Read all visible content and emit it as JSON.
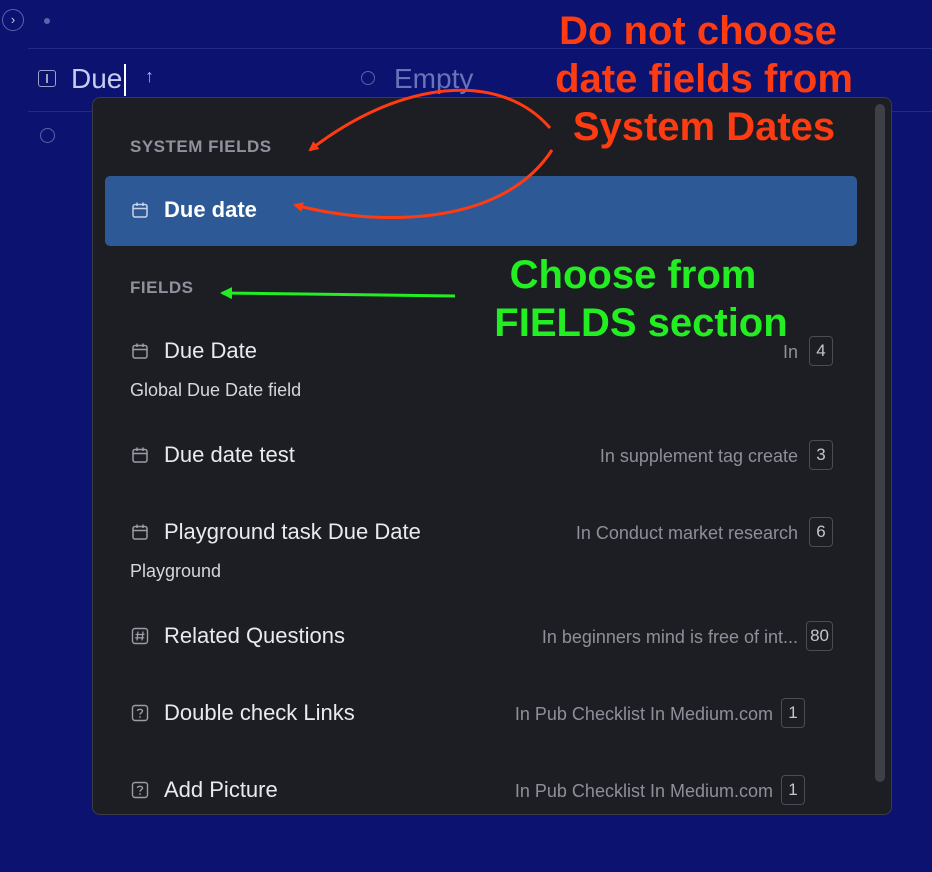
{
  "header": {
    "field_name": "Due",
    "value_placeholder": "Empty",
    "expand_glyph": "›",
    "sort_glyph": "↑"
  },
  "dropdown": {
    "system_section": {
      "title": "SYSTEM FIELDS",
      "items": [
        {
          "name": "Due date",
          "icon": "calendar-icon",
          "selected": true
        }
      ]
    },
    "fields_section": {
      "title": "FIELDS",
      "items": [
        {
          "name": "Due Date",
          "icon": "calendar-icon",
          "subtitle": "Global Due Date field",
          "location": "In",
          "count": "4"
        },
        {
          "name": "Due date test",
          "icon": "calendar-icon",
          "location": "In supplement tag create",
          "count": "3"
        },
        {
          "name": "Playground task Due Date",
          "icon": "calendar-icon",
          "subtitle": "Playground",
          "location": "In Conduct market research",
          "count": "6"
        },
        {
          "name": "Related Questions",
          "icon": "hash-icon",
          "location": "In beginners mind is free of int...",
          "count": "80"
        },
        {
          "name": "Double check Links",
          "icon": "question-icon",
          "location": "In Pub Checklist In Medium.com",
          "count": "1"
        },
        {
          "name": "Add Picture",
          "icon": "question-icon",
          "location": "In Pub Checklist In Medium.com",
          "count": "1"
        }
      ]
    }
  },
  "annotations": {
    "red_lines": [
      "Do not choose",
      "date fields from",
      "System Dates"
    ],
    "green_lines": [
      "Choose from",
      "FIELDS section"
    ],
    "colors": {
      "red": "#ff3b12",
      "green": "#22ee22"
    }
  },
  "colors": {
    "background": "#0b1270",
    "dropdown_bg": "#1d1e24",
    "selected_row": "#2d5a96"
  }
}
